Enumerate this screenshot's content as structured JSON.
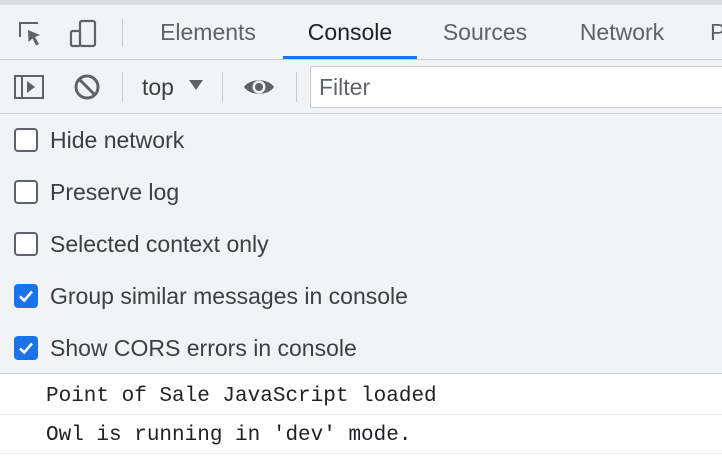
{
  "tabs": [
    {
      "label": "Elements",
      "active": false
    },
    {
      "label": "Console",
      "active": true
    },
    {
      "label": "Sources",
      "active": false
    },
    {
      "label": "Network",
      "active": false
    },
    {
      "label": "P",
      "active": false
    }
  ],
  "toolbar": {
    "context": "top",
    "filter_placeholder": "Filter"
  },
  "settings": [
    {
      "label": "Hide network",
      "checked": false
    },
    {
      "label": "Preserve log",
      "checked": false
    },
    {
      "label": "Selected context only",
      "checked": false
    },
    {
      "label": "Group similar messages in console",
      "checked": true
    },
    {
      "label": "Show CORS errors in console",
      "checked": true
    }
  ],
  "messages": [
    "Point of Sale JavaScript loaded",
    "Owl is running in 'dev' mode."
  ],
  "colors": {
    "accent": "#1a73e8",
    "panel": "#f1f3f4"
  },
  "icons": [
    "inspect-element-icon",
    "device-toolbar-icon",
    "sidebar-toggle-icon",
    "clear-console-icon",
    "chevron-down-icon",
    "live-expression-eye-icon",
    "checkmark-icon"
  ]
}
